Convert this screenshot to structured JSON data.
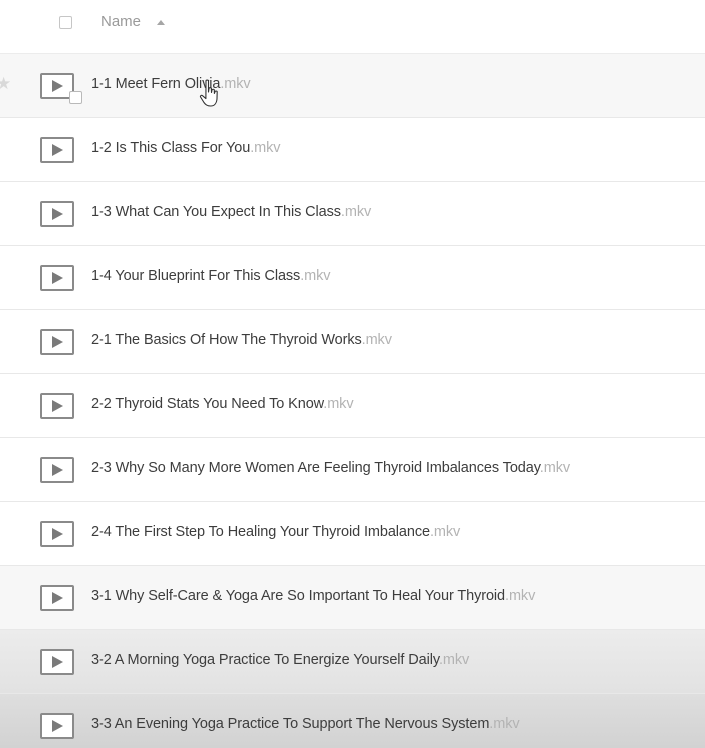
{
  "header": {
    "column_label": "Name"
  },
  "files": [
    {
      "base": "1-1 Meet Fern Olivia",
      "ext": ".mkv"
    },
    {
      "base": "1-2 Is This Class For You",
      "ext": ".mkv"
    },
    {
      "base": "1-3 What Can You Expect In This Class",
      "ext": ".mkv"
    },
    {
      "base": "1-4 Your Blueprint For This Class",
      "ext": ".mkv"
    },
    {
      "base": "2-1 The Basics Of How The Thyroid Works",
      "ext": ".mkv"
    },
    {
      "base": "2-2 Thyroid Stats You Need To Know",
      "ext": ".mkv"
    },
    {
      "base": "2-3 Why So Many More Women Are Feeling Thyroid Imbalances Today",
      "ext": ".mkv"
    },
    {
      "base": "2-4 The First Step To Healing Your Thyroid Imbalance",
      "ext": ".mkv"
    },
    {
      "base": "3-1 Why Self-Care & Yoga Are So Important To Heal Your Thyroid",
      "ext": ".mkv"
    },
    {
      "base": "3-2 A Morning Yoga Practice To Energize Yourself Daily",
      "ext": ".mkv"
    },
    {
      "base": "3-3 An Evening Yoga Practice To Support The Nervous System",
      "ext": ".mkv"
    }
  ],
  "icons": {
    "file": "video-file-icon",
    "star": "star-icon",
    "sort": "sort-ascending-icon",
    "cursor": "hand-pointer-cursor"
  }
}
